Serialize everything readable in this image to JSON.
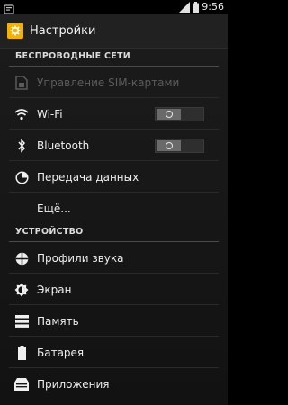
{
  "status_bar": {
    "time": "9:56",
    "icons": [
      "notification-icon",
      "signal-icon",
      "battery-icon"
    ]
  },
  "header": {
    "title": "Настройки",
    "icon": "settings-app-icon",
    "icon_color": "#f4b100"
  },
  "sections": [
    {
      "title": "БЕСПРОВОДНЫЕ СЕТИ",
      "items": [
        {
          "label": "Управление SIM-картами",
          "icon": "sim-card-icon",
          "enabled": false
        },
        {
          "label": "Wi-Fi",
          "icon": "wifi-icon",
          "toggle": "off"
        },
        {
          "label": "Bluetooth",
          "icon": "bluetooth-icon",
          "toggle": "off"
        },
        {
          "label": "Передача данных",
          "icon": "data-usage-icon"
        },
        {
          "label": "Ещё...",
          "icon": ""
        }
      ]
    },
    {
      "title": "УСТРОЙСТВО",
      "items": [
        {
          "label": "Профили звука",
          "icon": "sound-profiles-icon"
        },
        {
          "label": "Экран",
          "icon": "display-icon"
        },
        {
          "label": "Память",
          "icon": "storage-icon"
        },
        {
          "label": "Батарея",
          "icon": "battery-icon"
        },
        {
          "label": "Приложения",
          "icon": "apps-icon"
        }
      ]
    }
  ]
}
